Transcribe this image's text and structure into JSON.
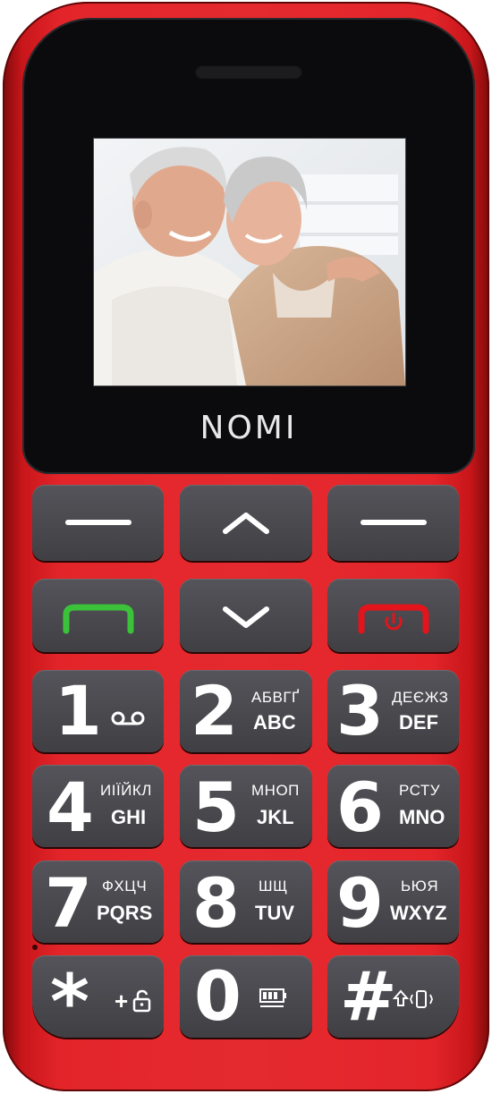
{
  "brand": "NOMI",
  "colors": {
    "body": "#e42a2f",
    "front": "#0b0b0d",
    "key": "#48484d",
    "call": "#3cc23a",
    "end": "#e3141b"
  },
  "screen": {
    "wallpaper": "elderly-couple-photo"
  },
  "soft_keys": {
    "left_icon": "dash-icon",
    "right_icon": "dash-icon"
  },
  "nav": {
    "up_icon": "chevron-up-icon",
    "down_icon": "chevron-down-icon"
  },
  "call_keys": {
    "call_icon": "call-icon",
    "end_icon": "end-call-power-icon"
  },
  "keys": [
    {
      "digit": "1",
      "latin": "",
      "cyrillic": "",
      "icon": "voicemail-icon"
    },
    {
      "digit": "2",
      "latin": "ABC",
      "cyrillic": "АБВГҐ"
    },
    {
      "digit": "3",
      "latin": "DEF",
      "cyrillic": "ДЕЄЖЗ"
    },
    {
      "digit": "4",
      "latin": "GHI",
      "cyrillic": "ИІЇЙКЛ"
    },
    {
      "digit": "5",
      "latin": "JKL",
      "cyrillic": "МНОП"
    },
    {
      "digit": "6",
      "latin": "MNO",
      "cyrillic": "РСТУ"
    },
    {
      "digit": "7",
      "latin": "PQRS",
      "cyrillic": "ФХЦЧ"
    },
    {
      "digit": "8",
      "latin": "TUV",
      "cyrillic": "ШЩ"
    },
    {
      "digit": "9",
      "latin": "WXYZ",
      "cyrillic": "ЬЮЯ"
    },
    {
      "digit": "*",
      "latin": "+",
      "cyrillic": "",
      "icon": "lock-icon"
    },
    {
      "digit": "0",
      "latin": "",
      "cyrillic": "",
      "icon": "battery-icon"
    },
    {
      "digit": "#",
      "latin": "",
      "cyrillic": "",
      "icon": "shift-vibrate-icon"
    }
  ]
}
